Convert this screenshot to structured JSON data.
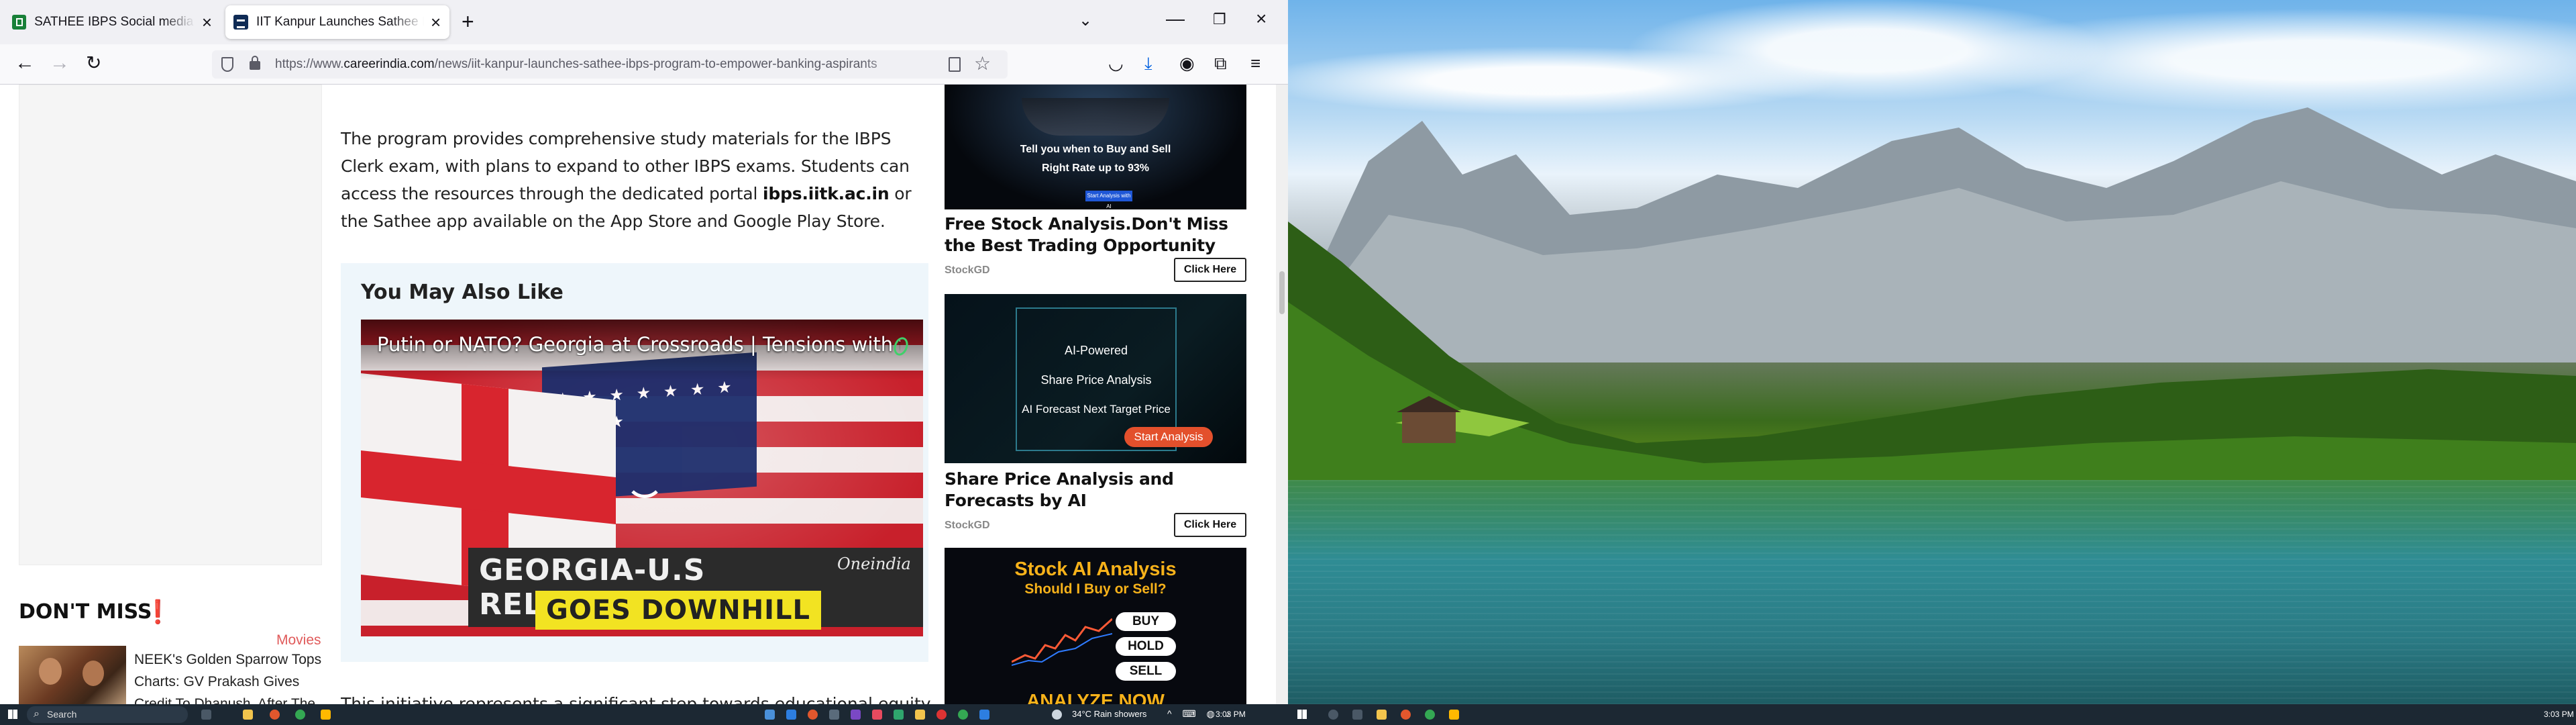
{
  "browser": {
    "tabs": [
      {
        "title": "SATHEE IBPS Social media link",
        "close": "×"
      },
      {
        "title": "IIT Kanpur Launches Sathee IBPS",
        "close": "×"
      }
    ],
    "new_tab": "+",
    "tab_list": "⌄",
    "window_controls": {
      "minimize": "—",
      "maximize": "❐",
      "close": "×"
    },
    "nav": {
      "back": "←",
      "forward": "→",
      "reload": "↻"
    },
    "url": {
      "prefix": "https://www.",
      "host": "careerindia.com",
      "path": "/news/iit-kanpur-launches-sathee-ibps-program-to-empower-banking-aspirants"
    },
    "toolbar_icons": {
      "star": "☆",
      "pocket": "◡",
      "download": "⤓",
      "account": "◉",
      "extensions": "⧉",
      "menu": "≡"
    }
  },
  "sidebar": {
    "dont_miss_title": "DON'T MISS",
    "dont_miss_mark": "❗",
    "item": {
      "category": "Movies",
      "headline": "NEEK's Golden Sparrow Tops Charts: GV Prakash Gives Credit To Dhanush, After The"
    }
  },
  "article": {
    "para1_part1": "The program provides comprehensive study materials for the IBPS Clerk exam, with plans to expand to other IBPS exams. Students can access the resources through the dedicated portal ",
    "para1_link": "ibps.iitk.ac.in",
    "para1_part2": " or the Sathee app available on the App Store and Google Play Store.",
    "related_title": "You May Also Like",
    "video": {
      "title": "Putin or NATO? Georgia at Crossroads | Tensions with th...",
      "caption1": "GEORGIA-U.S RELATIONSHIP",
      "caption2": "GOES DOWNHILL",
      "watermark": "Oneindia"
    },
    "para2": "This initiative represents a significant step towards educational equity in"
  },
  "ads": [
    {
      "image_line1": "Tell you when to Buy and Sell",
      "image_line2": "Right Rate up to 93%",
      "image_button": "Start Analysis with AI",
      "title": "Free Stock Analysis.Don't Miss the Best Trading Opportunity",
      "source": "StockGD",
      "cta": "Click Here"
    },
    {
      "image_line1": "AI-Powered",
      "image_line2": "Share Price Analysis",
      "image_line3": "AI Forecast Next Target Price",
      "image_button": "Start Analysis",
      "title": "Share Price Analysis and Forecasts by AI",
      "source": "StockGD",
      "cta": "Click Here"
    },
    {
      "image_h1": "Stock AI Analysis",
      "image_h2": "Should I Buy or Sell?",
      "pills": [
        "BUY",
        "HOLD",
        "SELL"
      ],
      "image_cta": "ANALYZE NOW"
    }
  ],
  "taskbar": {
    "search_label": "Search",
    "weather": "34°C  Rain showers",
    "clock_left": "3:03 PM",
    "clock_right": "3:03 PM"
  },
  "colors": {
    "accent_download": "#0060df",
    "category_red": "#e05a5a",
    "ad_gold": "#f7b21a",
    "taskbar": "#1c2833"
  }
}
